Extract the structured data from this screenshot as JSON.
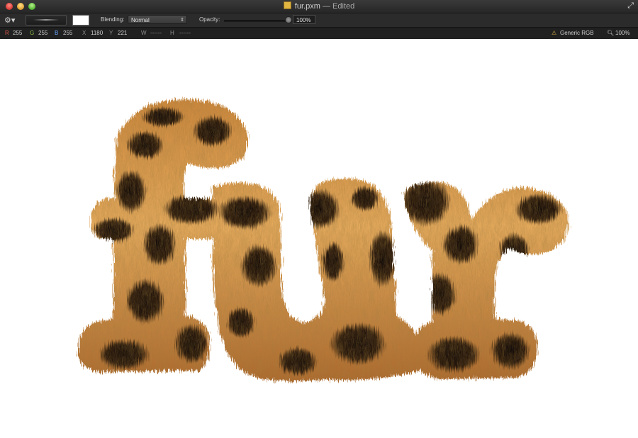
{
  "window": {
    "title": "fur.pxm",
    "title_status": "— Edited"
  },
  "toolbar": {
    "blending_label": "Blending:",
    "blending_value": "Normal",
    "opacity_label": "Opacity:",
    "opacity_value": "100%",
    "opacity_level": 1.0,
    "brush_color": "#ffffff"
  },
  "infobar": {
    "r_label": "R",
    "r_value": "255",
    "g_label": "G",
    "g_value": "255",
    "b_label": "B",
    "b_value": "255",
    "x_label": "X",
    "x_value": "1180",
    "y_label": "Y",
    "y_value": "221",
    "w_label": "W",
    "w_value": "------",
    "h_label": "H",
    "h_value": "------",
    "color_profile": "Generic RGB",
    "zoom": "100%"
  },
  "canvas": {
    "artwork": "furry leopard-print text",
    "fur_colors": [
      "#c9843a",
      "#e3a95c",
      "#8a5220",
      "#1e140c",
      "#f0c890"
    ]
  },
  "icons": [
    "close-icon",
    "minimize-icon",
    "zoom-icon",
    "document-icon",
    "fullscreen-icon",
    "gear-icon",
    "profile-icon",
    "zoom-tool-icon"
  ]
}
